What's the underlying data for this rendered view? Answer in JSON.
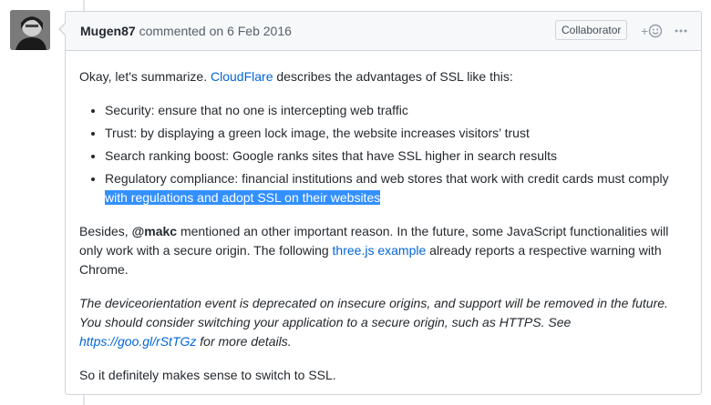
{
  "comment": {
    "author": "Mugen87",
    "action": "commented on",
    "date": "6 Feb 2016",
    "role_badge": "Collaborator",
    "reaction_icon": "smiley-add-icon",
    "more_icon": "kebab-horizontal-icon",
    "body": {
      "intro": {
        "before": "Okay, let's summarize. ",
        "link": "CloudFlare",
        "after": " describes the advantages of SSL like this:"
      },
      "bullets": [
        "Security: ensure that no one is intercepting web traffic",
        "Trust: by displaying a green lock image, the website increases visitors’ trust",
        "Search ranking boost: Google ranks sites that have SSL higher in search results"
      ],
      "last_bullet": {
        "text": "Regulatory compliance: financial institutions and web stores that work with credit cards must comply ",
        "selected": "with regulations and adopt SSL on their websites"
      },
      "para2": {
        "before": "Besides, ",
        "mention": "@makc",
        "middle": " mentioned an other important reason. In the future, some JavaScript functionalities will only work with a secure origin. The following ",
        "link": "three.js example",
        "after": " already reports a respective warning with Chrome."
      },
      "quote": {
        "before": "The deviceorientation event is deprecated on insecure origins, and support will be removed in the future. You should consider switching your application to a secure origin, such as HTTPS. See ",
        "link": "https://goo.gl/rStTGz",
        "after": " for more details."
      },
      "conclusion": "So it definitely makes sense to switch to SSL."
    }
  }
}
